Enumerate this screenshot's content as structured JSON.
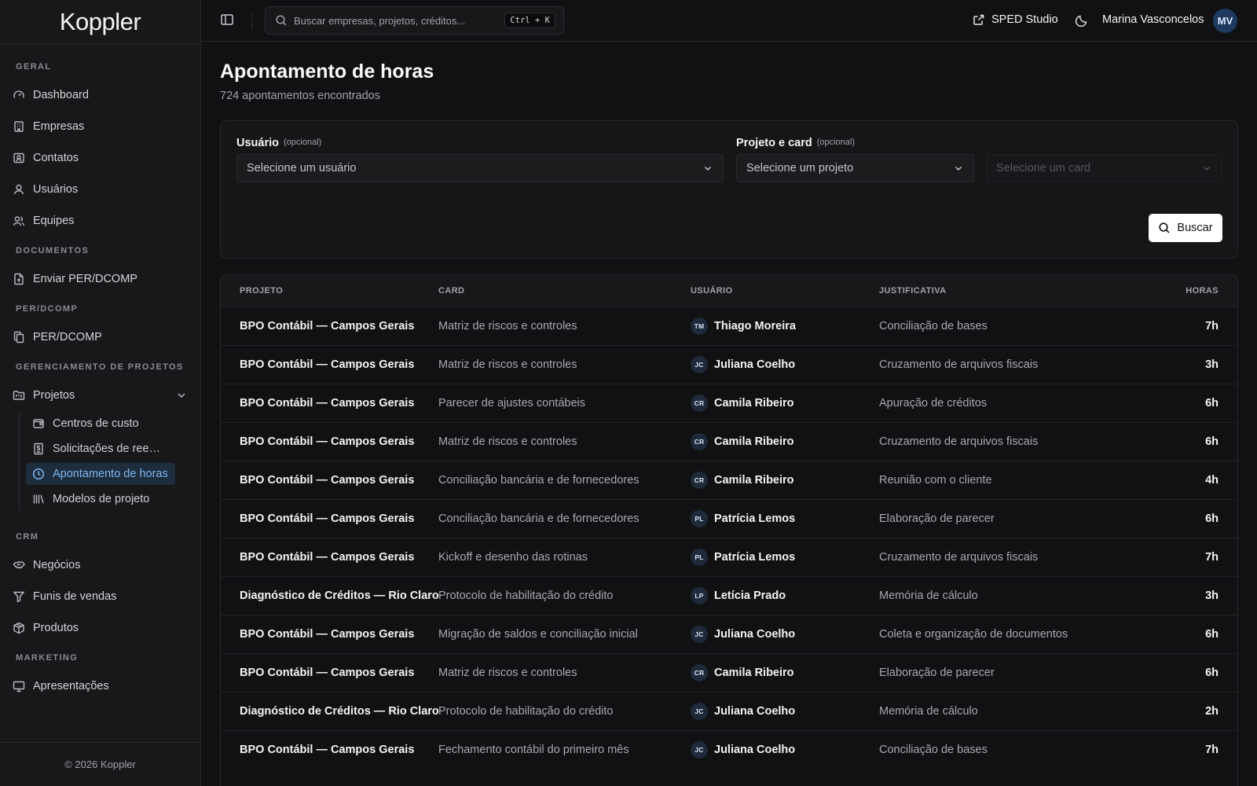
{
  "brand": {
    "logo": "Koppler",
    "footer": "© 2026 Koppler"
  },
  "sidebar": {
    "sections": [
      {
        "label": "GERAL",
        "items": [
          {
            "label": "Dashboard",
            "icon": "dashboard-gauge-icon"
          },
          {
            "label": "Empresas",
            "icon": "building-icon"
          },
          {
            "label": "Contatos",
            "icon": "contact-card-icon"
          },
          {
            "label": "Usuários",
            "icon": "user-icon"
          },
          {
            "label": "Equipes",
            "icon": "users-icon"
          }
        ]
      },
      {
        "label": "DOCUMENTOS",
        "items": [
          {
            "label": "Enviar PER/DCOMP",
            "icon": "file-upload-icon"
          }
        ]
      },
      {
        "label": "PER/DCOMP",
        "items": [
          {
            "label": "PER/DCOMP",
            "icon": "files-icon"
          }
        ]
      },
      {
        "label": "GERENCIAMENTO DE PROJETOS",
        "items": [
          {
            "label": "Projetos",
            "icon": "folder-kanban-icon"
          }
        ]
      },
      {
        "label": "CRM",
        "items": [
          {
            "label": "Negócios",
            "icon": "handshake-icon"
          },
          {
            "label": "Funis de vendas",
            "icon": "filter-icon"
          },
          {
            "label": "Produtos",
            "icon": "package-icon"
          }
        ]
      },
      {
        "label": "MARKETING",
        "items": [
          {
            "label": "Apresentações",
            "icon": "presentation-icon"
          }
        ]
      }
    ],
    "projects_sub": [
      {
        "label": "Centros de custo",
        "icon": "wallet-icon"
      },
      {
        "label": "Solicitações de reembolso",
        "icon": "receipt-icon"
      },
      {
        "label": "Apontamento de horas",
        "icon": "clock-icon",
        "active": true
      },
      {
        "label": "Modelos de projeto",
        "icon": "library-icon"
      }
    ]
  },
  "topbar": {
    "search_placeholder": "Buscar empresas, projetos, créditos...",
    "shortcut": "Ctrl + K",
    "sped_label": "SPED Studio",
    "user_name": "Marina Vasconcelos",
    "user_initials": "MV"
  },
  "page": {
    "title": "Apontamento de horas",
    "subtitle": "724 apontamentos encontrados"
  },
  "filters": {
    "user_label": "Usuário",
    "user_optional": "(opcional)",
    "user_placeholder": "Selecione um usuário",
    "project_label": "Projeto e card",
    "project_optional": "(opcional)",
    "project_placeholder": "Selecione um projeto",
    "card_placeholder": "Selecione um card",
    "search_button": "Buscar"
  },
  "table": {
    "headers": [
      "PROJETO",
      "CARD",
      "USUÁRIO",
      "JUSTIFICATIVA",
      "HORAS"
    ],
    "rows": [
      {
        "project": "BPO Contábil — Campos Gerais",
        "card": "Matriz de riscos e controles",
        "initials": "TM",
        "user": "Thiago Moreira",
        "reason": "Conciliação de bases",
        "hours": "7h"
      },
      {
        "project": "BPO Contábil — Campos Gerais",
        "card": "Matriz de riscos e controles",
        "initials": "JC",
        "user": "Juliana Coelho",
        "reason": "Cruzamento de arquivos fiscais",
        "hours": "3h"
      },
      {
        "project": "BPO Contábil — Campos Gerais",
        "card": "Parecer de ajustes contábeis",
        "initials": "CR",
        "user": "Camila Ribeiro",
        "reason": "Apuração de créditos",
        "hours": "6h"
      },
      {
        "project": "BPO Contábil — Campos Gerais",
        "card": "Matriz de riscos e controles",
        "initials": "CR",
        "user": "Camila Ribeiro",
        "reason": "Cruzamento de arquivos fiscais",
        "hours": "6h"
      },
      {
        "project": "BPO Contábil — Campos Gerais",
        "card": "Conciliação bancária e de fornecedores",
        "initials": "CR",
        "user": "Camila Ribeiro",
        "reason": "Reunião com o cliente",
        "hours": "4h"
      },
      {
        "project": "BPO Contábil — Campos Gerais",
        "card": "Conciliação bancária e de fornecedores",
        "initials": "PL",
        "user": "Patrícia Lemos",
        "reason": "Elaboração de parecer",
        "hours": "6h"
      },
      {
        "project": "BPO Contábil — Campos Gerais",
        "card": "Kickoff e desenho das rotinas",
        "initials": "PL",
        "user": "Patrícia Lemos",
        "reason": "Cruzamento de arquivos fiscais",
        "hours": "7h"
      },
      {
        "project": "Diagnóstico de Créditos — Rio Claro",
        "card": "Protocolo de habilitação do crédito",
        "initials": "LP",
        "user": "Letícia Prado",
        "reason": "Memória de cálculo",
        "hours": "3h"
      },
      {
        "project": "BPO Contábil — Campos Gerais",
        "card": "Migração de saldos e conciliação inicial",
        "initials": "JC",
        "user": "Juliana Coelho",
        "reason": "Coleta e organização de documentos",
        "hours": "6h"
      },
      {
        "project": "BPO Contábil — Campos Gerais",
        "card": "Matriz de riscos e controles",
        "initials": "CR",
        "user": "Camila Ribeiro",
        "reason": "Elaboração de parecer",
        "hours": "6h"
      },
      {
        "project": "Diagnóstico de Créditos — Rio Claro",
        "card": "Protocolo de habilitação do crédito",
        "initials": "JC",
        "user": "Juliana Coelho",
        "reason": "Memória de cálculo",
        "hours": "2h"
      },
      {
        "project": "BPO Contábil — Campos Gerais",
        "card": "Fechamento contábil do primeiro mês",
        "initials": "JC",
        "user": "Juliana Coelho",
        "reason": "Conciliação de bases",
        "hours": "7h"
      }
    ]
  }
}
